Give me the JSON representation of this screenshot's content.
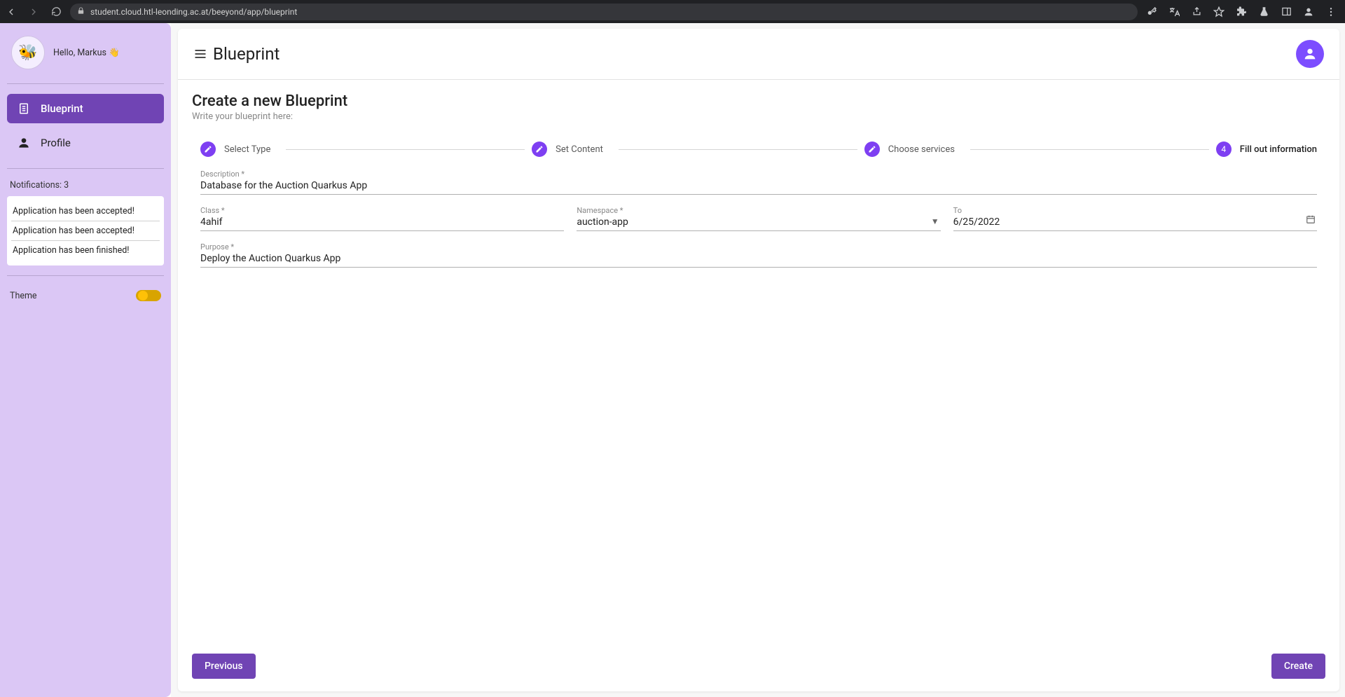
{
  "browser": {
    "url": "student.cloud.htl-leonding.ac.at/beeyond/app/blueprint"
  },
  "sidebar": {
    "greeting": "Hello, Markus 👋",
    "nav": [
      {
        "label": "Blueprint",
        "icon": "document"
      },
      {
        "label": "Profile",
        "icon": "account"
      }
    ],
    "notifications": {
      "header": "Notifications: 3",
      "items": [
        "Application has been accepted!",
        "Application has been accepted!",
        "Application has been finished!"
      ]
    },
    "theme_label": "Theme"
  },
  "header": {
    "title": "Blueprint"
  },
  "page": {
    "heading": "Create a new Blueprint",
    "subhead": "Write your blueprint here:"
  },
  "stepper": {
    "steps": [
      {
        "label": "Select Type",
        "state": "done"
      },
      {
        "label": "Set Content",
        "state": "done"
      },
      {
        "label": "Choose services",
        "state": "done"
      },
      {
        "label": "Fill out information",
        "state": "current",
        "number": "4"
      }
    ]
  },
  "form": {
    "description": {
      "label": "Description *",
      "value": "Database for the Auction Quarkus App"
    },
    "class": {
      "label": "Class *",
      "value": "4ahif"
    },
    "namespace": {
      "label": "Namespace *",
      "value": "auction-app"
    },
    "to": {
      "label": "To",
      "value": "6/25/2022"
    },
    "purpose": {
      "label": "Purpose *",
      "value": "Deploy the Auction Quarkus App"
    }
  },
  "footer": {
    "previous": "Previous",
    "create": "Create"
  }
}
